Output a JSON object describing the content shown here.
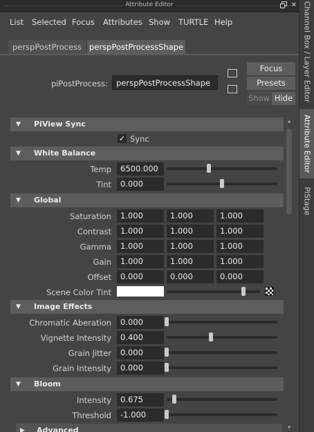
{
  "window": {
    "title": "Attribute Editor"
  },
  "menu": [
    "List",
    "Selected",
    "Focus",
    "Attributes",
    "Show",
    "TURTLE",
    "Help"
  ],
  "tabs": [
    {
      "label": "perspPostProcess"
    },
    {
      "label": "perspPostProcessShape"
    }
  ],
  "node": {
    "label": "piPostProcess:",
    "value": "perspPostProcessShape"
  },
  "buttons": {
    "focus": "Focus",
    "presets": "Presets",
    "show": "Show",
    "hide": "Hide"
  },
  "side_tabs": [
    "Channel Box / Layer Editor",
    "Attribute Editor",
    "PiStage"
  ],
  "sections": {
    "piview_sync": {
      "title": "PiView Sync",
      "sync_label": "Sync",
      "sync_checked": true
    },
    "white_balance": {
      "title": "White Balance",
      "temp": {
        "label": "Temp",
        "value": "6500.000",
        "slider": 0.38
      },
      "tint": {
        "label": "Tint",
        "value": "0.000",
        "slider": 0.5
      }
    },
    "global": {
      "title": "Global",
      "rows": [
        {
          "label": "Saturation",
          "values": [
            "1.000",
            "1.000",
            "1.000"
          ]
        },
        {
          "label": "Contrast",
          "values": [
            "1.000",
            "1.000",
            "1.000"
          ]
        },
        {
          "label": "Gamma",
          "values": [
            "1.000",
            "1.000",
            "1.000"
          ]
        },
        {
          "label": "Gain",
          "values": [
            "1.000",
            "1.000",
            "1.000"
          ]
        },
        {
          "label": "Offset",
          "values": [
            "0.000",
            "0.000",
            "0.000"
          ]
        }
      ],
      "scene_color_tint": {
        "label": "Scene Color Tint",
        "color": "#ffffff",
        "slider": 0.82
      }
    },
    "image_effects": {
      "title": "Image Effects",
      "rows": [
        {
          "label": "Chromatic Aberation",
          "value": "0.000",
          "slider": 0.0
        },
        {
          "label": "Vignette Intensity",
          "value": "0.400",
          "slider": 0.4
        },
        {
          "label": "Grain Jitter",
          "value": "0.000",
          "slider": 0.0
        },
        {
          "label": "Grain Intensity",
          "value": "0.000",
          "slider": 0.0
        }
      ]
    },
    "bloom": {
      "title": "Bloom",
      "rows": [
        {
          "label": "Intensity",
          "value": "0.675",
          "slider": 0.07
        },
        {
          "label": "Threshold",
          "value": "-1.000",
          "slider": 0.0
        }
      ]
    },
    "advanced": {
      "title": "Advanced"
    }
  },
  "colors": {
    "panel": "#444444",
    "header": "#5d5d5d",
    "field": "#2b2b2b",
    "accent_tab": "#5d5d5d"
  }
}
